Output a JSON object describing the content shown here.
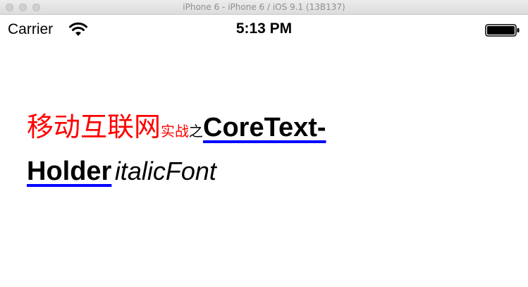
{
  "window": {
    "title": "iPhone 6 - iPhone 6 / iOS 9.1 (13B137)"
  },
  "status_bar": {
    "carrier": "Carrier",
    "time": "5:13 PM",
    "wifi_icon": "wifi-icon",
    "battery_icon": "battery-icon"
  },
  "content": {
    "segments": {
      "red_large": "移动互联网",
      "red_small": "实战",
      "black_small": "之",
      "bold_underlined": "CoreText-Holder",
      "italic": "italicFont"
    },
    "colors": {
      "red_text": "#ff0000",
      "underline": "#0000ff",
      "text": "#000000"
    }
  }
}
